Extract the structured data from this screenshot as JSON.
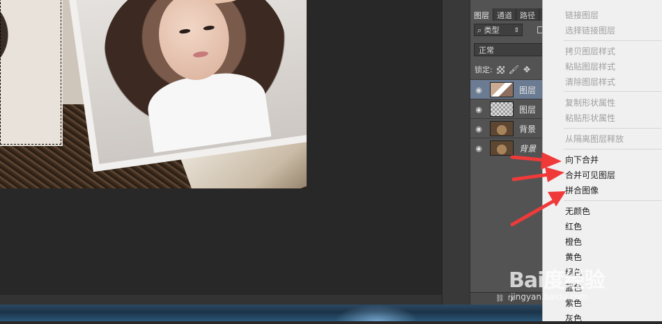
{
  "layers_panel": {
    "tabs": [
      "图层",
      "通道",
      "路径"
    ],
    "filter_label": "类型",
    "blend_mode": "正常",
    "lock_label": "锁定:",
    "layers": [
      {
        "name": "图层",
        "italic": false,
        "selected": true
      },
      {
        "name": "图层",
        "italic": false,
        "selected": false
      },
      {
        "name": "背景",
        "italic": false,
        "selected": false
      },
      {
        "name": "背景",
        "italic": true,
        "selected": false
      }
    ]
  },
  "context_menu": {
    "items": [
      {
        "label": "链接图层",
        "enabled": false
      },
      {
        "label": "选择链接图层",
        "enabled": false
      },
      {
        "label": "拷贝图层样式",
        "enabled": false
      },
      {
        "label": "粘贴图层样式",
        "enabled": false
      },
      {
        "label": "清除图层样式",
        "enabled": false
      },
      {
        "label": "复制形状属性",
        "enabled": false
      },
      {
        "label": "粘贴形状属性",
        "enabled": false
      },
      {
        "label": "从隔离图层释放",
        "enabled": false
      },
      {
        "label": "向下合并",
        "enabled": true
      },
      {
        "label": "合并可见图层",
        "enabled": true
      },
      {
        "label": "拼合图像",
        "enabled": true
      },
      {
        "label": "无颜色",
        "enabled": true
      },
      {
        "label": "红色",
        "enabled": true
      },
      {
        "label": "橙色",
        "enabled": true
      },
      {
        "label": "黄色",
        "enabled": true
      },
      {
        "label": "绿色",
        "enabled": true
      },
      {
        "label": "蓝色",
        "enabled": true
      },
      {
        "label": "紫色",
        "enabled": true
      },
      {
        "label": "灰色",
        "enabled": true
      }
    ]
  },
  "watermark": {
    "logo": "Bai度经验",
    "url": "jingyan.baidu.com"
  },
  "colors": {
    "arrow": "#f03a3a",
    "selected_layer": "#6b7b92"
  }
}
